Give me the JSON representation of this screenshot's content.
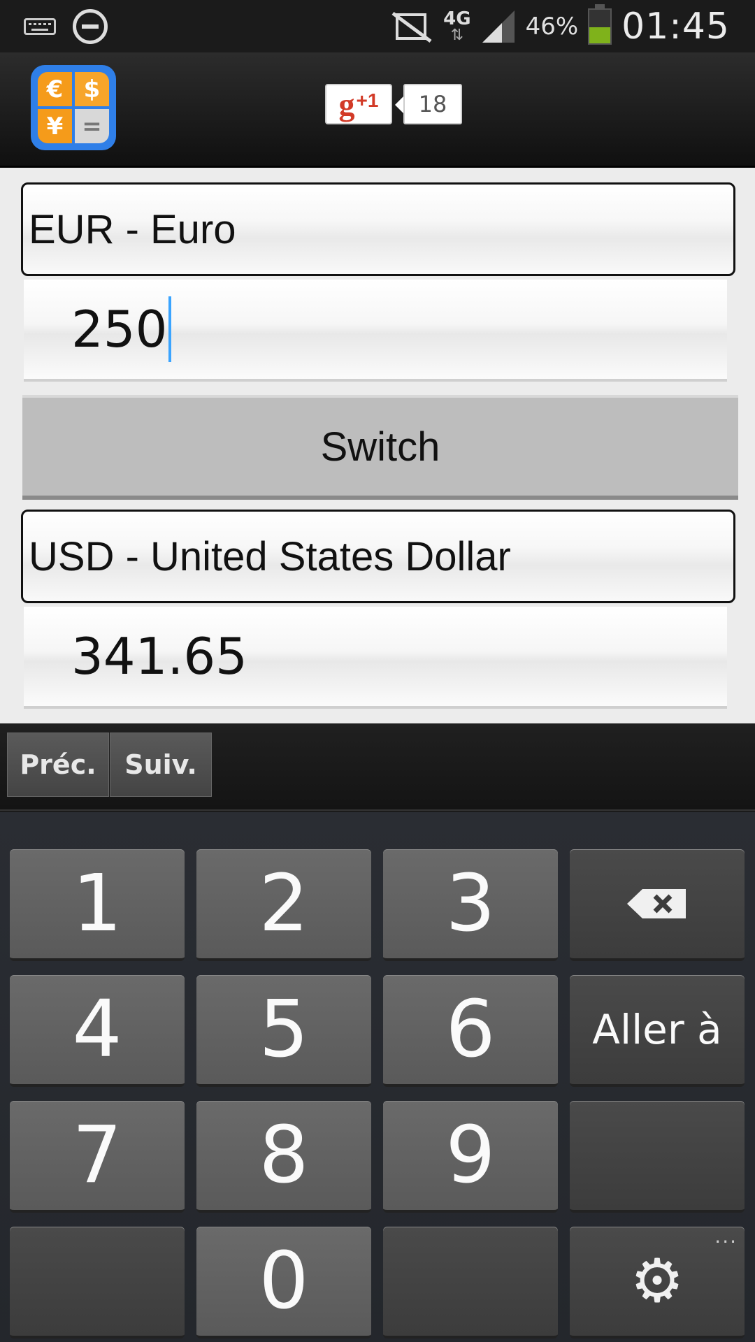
{
  "status_bar": {
    "network_type": "4G",
    "battery_percent": "46%",
    "battery_level": 0.46,
    "time": "01:45",
    "icons": [
      "keyboard-icon",
      "do-not-disturb-icon",
      "mute-icon",
      "data-arrows-icon",
      "signal-icon",
      "battery-icon"
    ]
  },
  "app_bar": {
    "logo_symbols": [
      "€",
      "$",
      "¥",
      "="
    ],
    "gplus_label": "+1",
    "gplus_count": "18"
  },
  "converter": {
    "from_currency": "EUR - Euro",
    "from_amount": "250",
    "switch_label": "Switch",
    "to_currency": "USD - United States Dollar",
    "to_amount": "341.65"
  },
  "keyboard": {
    "prev_label": "Préc.",
    "next_label": "Suiv.",
    "keys": [
      "1",
      "2",
      "3",
      "4",
      "5",
      "6",
      "7",
      "8",
      "9",
      "0"
    ],
    "go_label": "Aller à",
    "more_indicator": "..."
  }
}
